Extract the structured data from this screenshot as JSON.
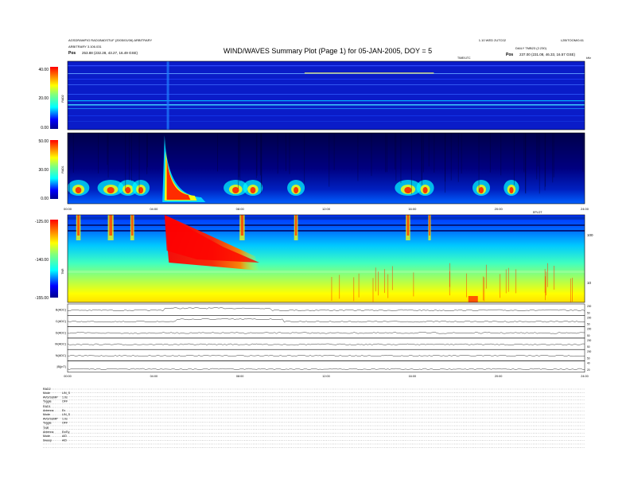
{
  "header": {
    "title": "WIND/WAVES Summary Plot (Page 1) for 05-JAN-2005, DOY = 5",
    "left_line1": "AGSDRAWFIG RAD1BADSTUF (2005/01/06) ARBITRARY",
    "left_line2": "ARBITRARY 3.106.031",
    "left_pos_label": "Pos",
    "left_pos_value": "253.88 (232.28, 43.27, 16.49 GSE)",
    "right_line1": "1.10 WED 2UTC02",
    "right_line2": "DAILY TMB23 (2.230)",
    "right_pos_label": "Pos",
    "right_pos_value": "237.00 (231.08, 46.33, 16.57 GSE)",
    "right_top": "L2B/TOOM/0.61",
    "time_axis_title": "TIME/UTC",
    "khz_label": "kHz",
    "eplot_label": "EPLOT"
  },
  "chart_data": [
    {
      "type": "heatmap",
      "name": "RAD2",
      "ylabel": "RAD2",
      "yticks": [
        "40.00",
        "20.00",
        "0.00"
      ],
      "ylim": [
        0,
        40
      ],
      "colorbar": "jet",
      "xlim": [
        0,
        24
      ]
    },
    {
      "type": "heatmap",
      "name": "RAD1",
      "ylabel": "RAD1",
      "yticks": [
        "50.00",
        "30.00",
        "0.00"
      ],
      "ylim": [
        0,
        50
      ],
      "colorbar": "jet",
      "xlim": [
        0,
        24
      ],
      "xticks": [
        "00:00",
        "04:00",
        "08:00",
        "12:00",
        "16:00",
        "20:00",
        "24:00"
      ]
    },
    {
      "type": "heatmap",
      "name": "TNR",
      "ylabel": "TNR",
      "yticks": [
        "-125.00",
        "-140.00",
        "-155.00"
      ],
      "ylim": [
        -155,
        -125
      ],
      "right_ticks": [
        "100",
        "10"
      ],
      "colorbar": "jet",
      "xlim": [
        0,
        24
      ]
    },
    {
      "type": "line",
      "name": "aux-panels",
      "panels": [
        {
          "label": "B(ADC)",
          "right_ticks": [
            "200",
            "50"
          ]
        },
        {
          "label": "C(ADC)",
          "right_ticks": [
            "200",
            "50"
          ]
        },
        {
          "label": "D(ADC)",
          "right_ticks": [
            "200",
            "50"
          ]
        },
        {
          "label": "M(ADC)",
          "right_ticks": [
            "200",
            "50"
          ]
        },
        {
          "label": "N(ADC)",
          "right_ticks": [
            "200",
            "50"
          ]
        },
        {
          "label": "|B|(nT)",
          "right_ticks": [
            "40",
            "20"
          ]
        }
      ],
      "xticks": [
        "00:00",
        "04:00",
        "08:00",
        "12:00",
        "16:00",
        "20:00",
        "24:00"
      ],
      "xlim": [
        0,
        24
      ]
    }
  ],
  "settings": {
    "rad2_block": [
      {
        "k": "RAD2",
        "v": ""
      },
      {
        "k": "Mode",
        "v": "LIN_S"
      },
      {
        "k": "AVG/SUMP",
        "v": "1.0s"
      },
      {
        "k": "Toggle",
        "v": "OFF"
      }
    ],
    "rad1_block": [
      {
        "k": "RAD1",
        "v": ""
      },
      {
        "k": "Antenna",
        "v": "Ex"
      },
      {
        "k": "Mode",
        "v": "LIN_S"
      },
      {
        "k": "AVG/SUMP",
        "v": "1.0s"
      },
      {
        "k": "Toggle",
        "v": "OFF"
      }
    ],
    "tnr_block": [
      {
        "k": "TNR",
        "v": ""
      },
      {
        "k": "Antenna",
        "v": "Ex/Ey"
      },
      {
        "k": "Mode",
        "v": "A/D"
      },
      {
        "k": "Sweep",
        "v": "A/D"
      }
    ]
  },
  "colors": {
    "jet_low": "#00008f",
    "jet_mid": "#00ffff",
    "jet_high": "#ff0000"
  }
}
